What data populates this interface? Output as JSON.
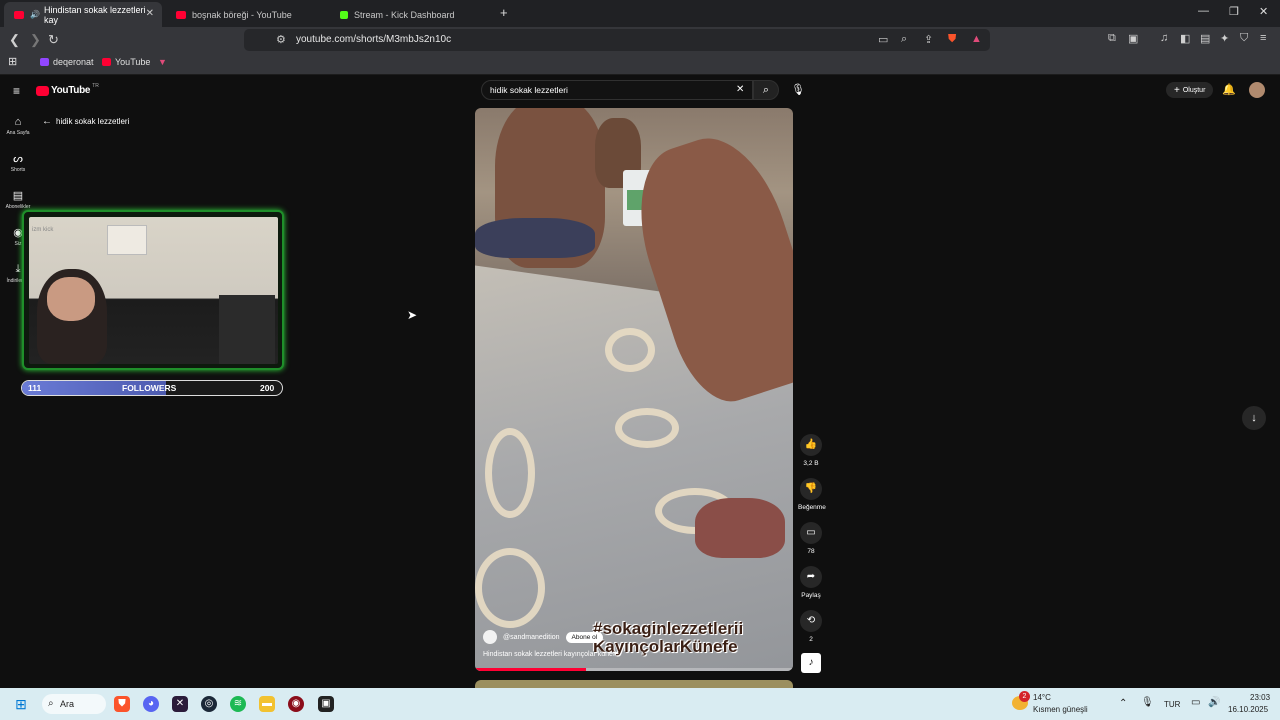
{
  "browser": {
    "tabs": [
      {
        "title": "Hindistan sokak lezzetleri kay",
        "color": "#ff0033",
        "active": true
      },
      {
        "title": "boşnak böreği - YouTube",
        "color": "#ff0033",
        "active": false
      },
      {
        "title": "Stream - Kick Dashboard",
        "color": "#53fc18",
        "active": false
      }
    ],
    "new_tab_label": "+",
    "url": "youtube.com/shorts/M3mbJs2n10c",
    "bookmarks": [
      {
        "label": "deqeronat",
        "color": "#9146ff"
      },
      {
        "label": "YouTube",
        "color": "#ff0033"
      }
    ]
  },
  "youtube": {
    "logo": "YouTube",
    "region": "TR",
    "back_label": "hidik sokak lezzetleri",
    "search_value": "hidik sokak lezzetleri",
    "create_label": "Oluştur",
    "sidebar": [
      {
        "label": "Ana Sayfa",
        "icon": "home-icon"
      },
      {
        "label": "Shorts",
        "icon": "shorts-icon"
      },
      {
        "label": "Abonelikler",
        "icon": "subscriptions-icon"
      },
      {
        "label": "Siz",
        "icon": "you-icon"
      },
      {
        "label": "İndirilenler",
        "icon": "downloads-icon"
      }
    ],
    "short": {
      "channel": "@sandmanedition",
      "subscribe_label": "Abone ol",
      "overlay_line1": "#sokaginlezzetlerii",
      "overlay_line2": "KayınçolarKünefe",
      "caption": "Hindistan sokak lezzetleri kayınçolar künefe",
      "progress": 0.35
    },
    "actions": {
      "likes": "3,2 B",
      "dislike_label": "Beğenme",
      "comments": "78",
      "share_label": "Paylaş",
      "remix": "2"
    }
  },
  "stream_overlay": {
    "webcam_label": "izm kick",
    "followers_current": "111",
    "followers_label": "FOLLOWERS",
    "followers_goal": "200",
    "followers_fraction": 0.555
  },
  "taskbar": {
    "search_label": "Ara",
    "weather_temp": "14°C",
    "weather_desc": "Kısmen güneşli",
    "weather_badge": "2",
    "language": "TUR",
    "time": "23:03",
    "date": "16.10.2025"
  }
}
